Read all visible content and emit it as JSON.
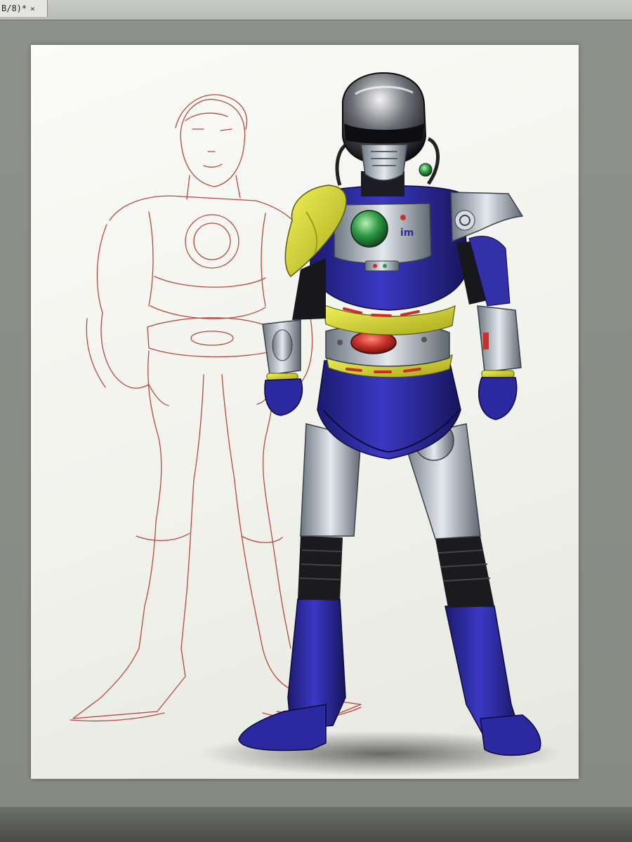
{
  "window": {
    "tab_title": "B/8)*",
    "close_glyph": "×"
  },
  "canvas": {
    "background": "#8b8d87",
    "artboard_color": "#f6f6f1"
  },
  "artwork": {
    "sketch_color": "#b5483f",
    "suit_primary": "#2e2b9c",
    "suit_silver": "#b9c2cc",
    "accent_yellow": "#d8d82a",
    "chest_lamp": "#2f9a44",
    "belt_gem": "#c8312b",
    "chest_logo": "im"
  }
}
